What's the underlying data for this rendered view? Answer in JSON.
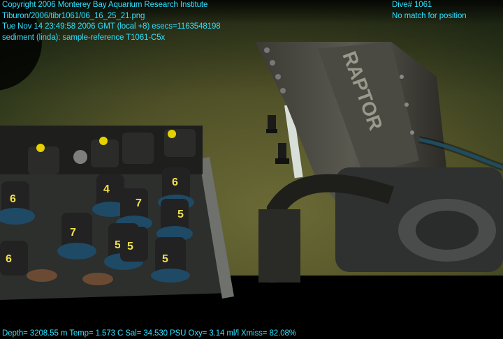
{
  "header_left": [
    "Copyright 2006 Monterey Bay Aquarium Research Institute",
    "Tiburon/2006/tibr1061/06_16_25_21.png",
    "Tue Nov 14 23:49:58 2006 GMT (local +8)  esecs=1163548198",
    "sediment (linda): sample-reference T1061-C5x"
  ],
  "header_right": [
    "Dive# 1061",
    "No match for position"
  ],
  "footer": "Depth= 3208.55 m  Temp= 1.573 C  Sal= 34.530 PSU  Oxy= 3.14 ml/l  Xmiss= 82.08%",
  "scene": {
    "arm_label": "RAPTOR",
    "core_labels": [
      "6",
      "4",
      "7",
      "6",
      "5",
      "7",
      "5",
      "5",
      "5",
      "6"
    ],
    "colors": {
      "overlay_text": "#2fe0ff",
      "seafloor": "#5a5a2e",
      "water": "#2e3a22"
    }
  }
}
